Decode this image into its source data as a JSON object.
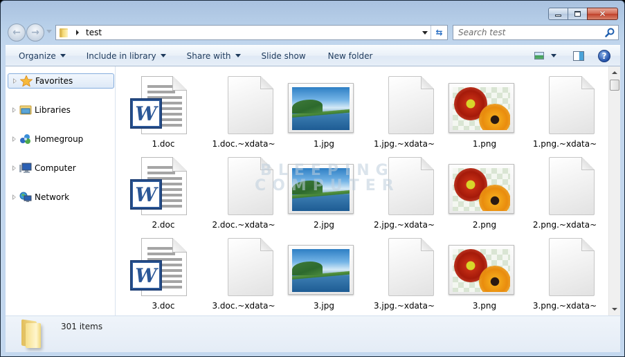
{
  "window": {
    "caption_buttons": {
      "minimize": "minimize",
      "maximize": "maximize",
      "close": "close"
    }
  },
  "address_bar": {
    "breadcrumb": [
      "test"
    ],
    "refresh_icon": "refresh-icon"
  },
  "search": {
    "placeholder": "Search test",
    "value": ""
  },
  "toolbar": {
    "organize": "Organize",
    "include_in_library": "Include in library",
    "share_with": "Share with",
    "slide_show": "Slide show",
    "new_folder": "New folder"
  },
  "navigation_pane": {
    "items": [
      {
        "label": "Favorites",
        "icon": "star-icon",
        "selected": true
      },
      {
        "label": "Libraries",
        "icon": "libraries-icon",
        "selected": false
      },
      {
        "label": "Homegroup",
        "icon": "homegroup-icon",
        "selected": false
      },
      {
        "label": "Computer",
        "icon": "computer-icon",
        "selected": false
      },
      {
        "label": "Network",
        "icon": "network-icon",
        "selected": false
      }
    ]
  },
  "files": [
    {
      "name": "1.doc",
      "type": "word"
    },
    {
      "name": "1.doc.~xdata~",
      "type": "blank"
    },
    {
      "name": "1.jpg",
      "type": "jpg"
    },
    {
      "name": "1.jpg.~xdata~",
      "type": "blank"
    },
    {
      "name": "1.png",
      "type": "png"
    },
    {
      "name": "1.png.~xdata~",
      "type": "blank"
    },
    {
      "name": "2.doc",
      "type": "word"
    },
    {
      "name": "2.doc.~xdata~",
      "type": "blank"
    },
    {
      "name": "2.jpg",
      "type": "jpg"
    },
    {
      "name": "2.jpg.~xdata~",
      "type": "blank"
    },
    {
      "name": "2.png",
      "type": "png"
    },
    {
      "name": "2.png.~xdata~",
      "type": "blank"
    },
    {
      "name": "3.doc",
      "type": "word"
    },
    {
      "name": "3.doc.~xdata~",
      "type": "blank"
    },
    {
      "name": "3.jpg",
      "type": "jpg"
    },
    {
      "name": "3.jpg.~xdata~",
      "type": "blank"
    },
    {
      "name": "3.png",
      "type": "png"
    },
    {
      "name": "3.png.~xdata~",
      "type": "blank"
    }
  ],
  "watermark": {
    "line1": "BLEEPING",
    "line2": "COMPUTER"
  },
  "details_pane": {
    "item_count": "301 items"
  }
}
